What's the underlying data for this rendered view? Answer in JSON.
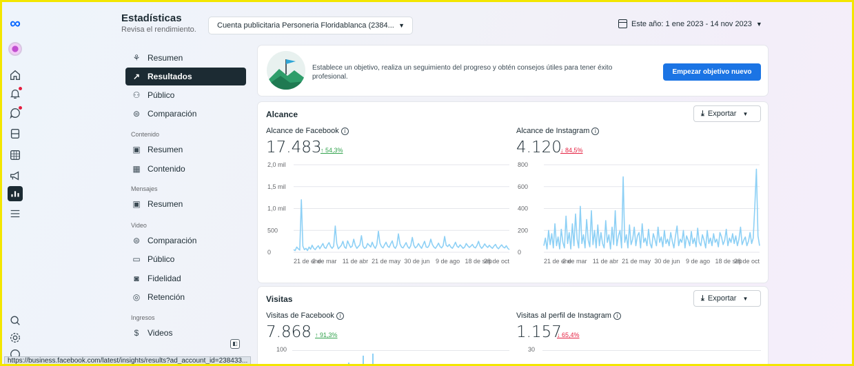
{
  "header": {
    "title": "Estadísticas",
    "subtitle": "Revisa el rendimiento.",
    "account_selector": "Cuenta publicitaria Personeria Floridablanca (2384...",
    "date_range": "Este año: 1 ene 2023 - 14 nov 2023"
  },
  "rail": {
    "icons": [
      "meta-logo-icon",
      "avatar",
      "home-icon",
      "notifications-icon",
      "messages-icon",
      "content-icon",
      "planner-icon",
      "ads-icon",
      "insights-icon",
      "menu-icon",
      "search-icon",
      "settings-icon",
      "help-icon"
    ]
  },
  "nav": {
    "resumen": "Resumen",
    "resultados": "Resultados",
    "publico": "Público",
    "comparacion": "Comparación",
    "section_contenido": "Contenido",
    "contenido_resumen": "Resumen",
    "contenido": "Contenido",
    "section_mensajes": "Mensajes",
    "mensajes_resumen": "Resumen",
    "section_video": "Video",
    "video_comparacion": "Comparación",
    "video_publico": "Público",
    "fidelidad": "Fidelidad",
    "retencion": "Retención",
    "section_ingresos": "Ingresos",
    "videos": "Videos"
  },
  "goal": {
    "text": "Establece un objetivo, realiza un seguimiento del progreso y obtén consejos útiles para tener éxito profesional.",
    "button": "Empezar objetivo nuevo"
  },
  "alcance": {
    "title": "Alcance",
    "export": "Exportar",
    "facebook": {
      "label": "Alcance de Facebook",
      "value": "17.483",
      "delta": "54,3%",
      "direction": "up"
    },
    "instagram": {
      "label": "Alcance de Instagram",
      "value": "4.120",
      "delta": "84,5%",
      "direction": "down"
    }
  },
  "visitas": {
    "title": "Visitas",
    "export": "Exportar",
    "facebook": {
      "label": "Visitas de Facebook",
      "value": "7.868",
      "delta": "91,3%",
      "direction": "up",
      "ytick_top": "100"
    },
    "instagram": {
      "label": "Visitas al perfil de Instagram",
      "value": "1.157",
      "delta": "65,4%",
      "direction": "down",
      "ytick_top": "30"
    }
  },
  "colors": {
    "accent": "#1b74e4",
    "line": "#8dd0f5",
    "up": "#31a24c",
    "down": "#e41e3f"
  },
  "status_url": "https://business.facebook.com/latest/insights/results?ad_account_id=238433...",
  "chart_data": [
    {
      "type": "line",
      "title": "Alcance de Facebook",
      "ylim": [
        0,
        2000
      ],
      "yticks": [
        "0",
        "500",
        "1,0 mil",
        "1,5 mil",
        "2,0 mil"
      ],
      "ytick_values": [
        0,
        500,
        1000,
        1500,
        2000
      ],
      "xticks": [
        "21 de ene",
        "2 de mar",
        "11 de abr",
        "21 de may",
        "30 de jun",
        "9 de ago",
        "18 de sep",
        "28 de oct"
      ],
      "series": [
        {
          "values": [
            60,
            40,
            120,
            80,
            50,
            1200,
            140,
            60,
            90,
            40,
            120,
            70,
            160,
            90,
            60,
            110,
            150,
            80,
            140,
            200,
            110,
            90,
            170,
            220,
            130,
            90,
            140,
            600,
            200,
            80,
            120,
            160,
            250,
            120,
            90,
            260,
            180,
            110,
            140,
            300,
            160,
            90,
            130,
            170,
            380,
            140,
            90,
            110,
            200,
            160,
            120,
            230,
            140,
            90,
            170,
            480,
            210,
            130,
            100,
            170,
            230,
            140,
            110,
            190,
            260,
            130,
            90,
            160,
            420,
            190,
            120,
            100,
            160,
            220,
            130,
            90,
            150,
            340,
            160,
            100,
            130,
            200,
            140,
            90,
            170,
            250,
            120,
            110,
            160,
            300,
            180,
            120,
            90,
            140,
            210,
            130,
            100,
            150,
            360,
            160,
            130,
            180,
            120,
            90,
            150,
            230,
            140,
            110,
            170,
            130,
            90,
            120,
            200,
            150,
            110,
            140,
            180,
            120,
            100,
            160,
            250,
            140,
            90,
            130,
            190,
            140,
            110,
            160,
            120,
            90,
            140,
            180,
            110,
            80,
            130,
            170,
            120,
            100,
            150,
            90,
            60
          ]
        }
      ]
    },
    {
      "type": "line",
      "title": "Alcance de Instagram",
      "ylim": [
        0,
        800
      ],
      "yticks": [
        "0",
        "200",
        "400",
        "600",
        "800"
      ],
      "ytick_values": [
        0,
        200,
        400,
        600,
        800
      ],
      "xticks": [
        "21 de ene",
        "2 de mar",
        "11 de abr",
        "21 de may",
        "30 de jun",
        "9 de ago",
        "18 de sep",
        "28 de oct"
      ],
      "series": [
        {
          "values": [
            60,
            130,
            30,
            200,
            70,
            170,
            40,
            260,
            60,
            140,
            30,
            210,
            90,
            40,
            330,
            80,
            180,
            30,
            260,
            60,
            350,
            120,
            40,
            420,
            80,
            160,
            40,
            300,
            110,
            50,
            380,
            70,
            200,
            40,
            250,
            60,
            180,
            80,
            40,
            290,
            90,
            160,
            30,
            230,
            70,
            380,
            60,
            150,
            200,
            40,
            690,
            90,
            160,
            40,
            250,
            70,
            120,
            230,
            60,
            150,
            180,
            40,
            260,
            90,
            130,
            60,
            210,
            80,
            40,
            170,
            120,
            60,
            230,
            90,
            140,
            50,
            200,
            80,
            120,
            60,
            180,
            100,
            40,
            150,
            240,
            60,
            120,
            90,
            200,
            40,
            150,
            110,
            60,
            190,
            80,
            130,
            50,
            220,
            90,
            60,
            160,
            110,
            40,
            200,
            80,
            130,
            60,
            170,
            90,
            120,
            50,
            180,
            140,
            70,
            110,
            210,
            60,
            130,
            90,
            170,
            80,
            150,
            60,
            120,
            230,
            70,
            110,
            140,
            60,
            100,
            180,
            80,
            130,
            420,
            760,
            150,
            60
          ]
        }
      ]
    },
    {
      "type": "bar",
      "title": "Visitas de Facebook",
      "yticks": [
        "100"
      ],
      "note": "Chart cropped at bottom of screenshot; only top tick and a few bar tips are visible."
    },
    {
      "type": "line",
      "title": "Visitas al perfil de Instagram",
      "yticks": [
        "30"
      ],
      "note": "Chart cropped at bottom of screenshot; only top tick is visible."
    }
  ]
}
